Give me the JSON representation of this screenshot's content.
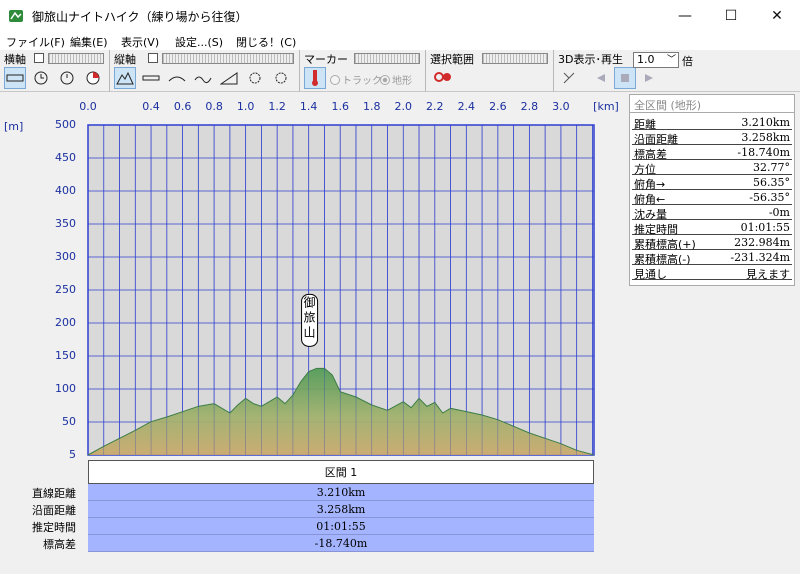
{
  "window": {
    "title": "御旅山ナイトハイク（練り場から往復）",
    "min_glyph": "—",
    "max_glyph": "☐",
    "close_glyph": "✕"
  },
  "menu": [
    "ファイル(F)",
    "編集(E)",
    "表示(V)",
    "設定...(S)",
    "閉じる！(C)"
  ],
  "toolbar": {
    "horizontal_label": "横軸",
    "vertical_label": "縦軸",
    "marker_label": "マーカー",
    "track_option": "トラック",
    "terrain_option": "地形",
    "range_label": "選択範囲",
    "display3d_label": "3D表示･再生",
    "zoom_value": "1.0",
    "zoom_unit": "倍",
    "accent": "#cde4f7"
  },
  "chart_data": {
    "type": "area",
    "x_unit": "[km]",
    "y_unit": "[m]",
    "x_ticks": [
      "0.0",
      "0.4",
      "0.6",
      "0.8",
      "1.0",
      "1.2",
      "1.4",
      "1.6",
      "1.8",
      "2.0",
      "2.2",
      "2.4",
      "2.6",
      "2.8",
      "3.0"
    ],
    "y_ticks": [
      "500",
      "450",
      "400",
      "350",
      "300",
      "250",
      "200",
      "150",
      "100",
      "50",
      "5"
    ],
    "xlim": [
      0,
      3.21
    ],
    "ylim": [
      5,
      500
    ],
    "grid": true,
    "peak_label": "御旅山",
    "x": [
      0,
      0.1,
      0.2,
      0.3,
      0.4,
      0.5,
      0.6,
      0.7,
      0.8,
      0.9,
      0.95,
      1.0,
      1.05,
      1.1,
      1.15,
      1.2,
      1.25,
      1.3,
      1.35,
      1.4,
      1.45,
      1.5,
      1.55,
      1.6,
      1.7,
      1.8,
      1.9,
      2.0,
      2.05,
      2.1,
      2.15,
      2.2,
      2.25,
      2.3,
      2.4,
      2.5,
      2.6,
      2.7,
      2.8,
      2.9,
      3.0,
      3.1,
      3.21
    ],
    "y": [
      5,
      18,
      30,
      42,
      55,
      62,
      70,
      78,
      82,
      68,
      80,
      90,
      82,
      78,
      85,
      92,
      82,
      95,
      115,
      130,
      135,
      135,
      125,
      100,
      92,
      80,
      72,
      85,
      76,
      90,
      78,
      84,
      68,
      75,
      70,
      65,
      58,
      48,
      38,
      30,
      22,
      12,
      5
    ],
    "colors": {
      "top": "#4f9a55",
      "mid": "#9fb06a",
      "bottom": "#c9a86a",
      "grid": "#2f3fd0",
      "plot_bg": "#d9d9d9"
    }
  },
  "segment": {
    "header": "区間 1",
    "rows": [
      {
        "label": "直線距離",
        "value": "3.210km"
      },
      {
        "label": "沿面距離",
        "value": "3.258km"
      },
      {
        "label": "推定時間",
        "value": "01:01:55"
      },
      {
        "label": "標高差",
        "value": "-18.740m"
      }
    ]
  },
  "panel": {
    "title": "全区間 (地形)",
    "rows": [
      {
        "key": "距離",
        "value": "3.210km"
      },
      {
        "key": "沿面距離",
        "value": "3.258km"
      },
      {
        "key": "標高差",
        "value": "-18.740m"
      },
      {
        "key": "方位",
        "value": "32.77°"
      },
      {
        "key": "俯角→",
        "value": "56.35°"
      },
      {
        "key": "俯角←",
        "value": "-56.35°"
      },
      {
        "key": "沈み量",
        "value": "-0m"
      },
      {
        "key": "推定時間",
        "value": "01:01:55"
      },
      {
        "key": "累積標高(+)",
        "value": "232.984m"
      },
      {
        "key": "累積標高(-)",
        "value": "-231.324m"
      },
      {
        "key": "見通し",
        "value": "見えます"
      }
    ]
  }
}
